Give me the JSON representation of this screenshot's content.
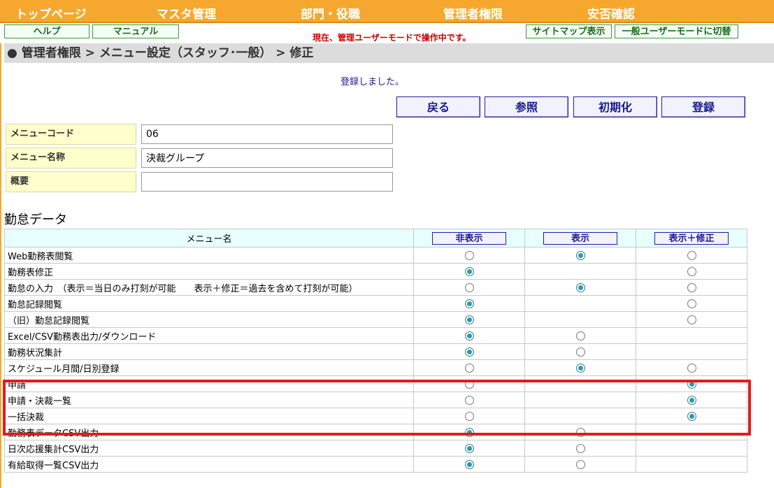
{
  "nav": [
    "トップページ",
    "マスタ管理",
    "部門・役職",
    "管理者権限",
    "安否確認"
  ],
  "subnav": {
    "help": "ヘルプ",
    "manual": "マニュアル",
    "notice": "現在、管理ユーザーモードで操作中です。",
    "sitemap": "サイトマップ表示",
    "switch": "一般ユーザーモードに切替"
  },
  "breadcrumb": "● 管理者権限 > メニュー設定（スタッフ･一般） > 修正",
  "message": "登録しました。",
  "actions": {
    "back": "戻る",
    "ref": "参照",
    "init": "初期化",
    "save": "登録"
  },
  "form": {
    "code_label": "メニューコード",
    "code_value": "06",
    "name_label": "メニュー名称",
    "name_value": "決裁グループ",
    "desc_label": "概要",
    "desc_value": ""
  },
  "section_title": "勤怠データ",
  "table": {
    "headers": {
      "menu": "メニュー名",
      "hide": "非表示",
      "show": "表示",
      "edit": "表示＋修正"
    },
    "rows": [
      {
        "name": "Web勤務表閲覧",
        "hide": "off",
        "show": "on",
        "edit": "off"
      },
      {
        "name": "勤務表修正",
        "hide": "on",
        "show": "none",
        "edit": "off"
      },
      {
        "name": "勤怠の入力　（表示＝当日のみ打刻が可能　　表示＋修正＝過去を含めて打刻が可能）",
        "hide": "off",
        "show": "on",
        "edit": "off"
      },
      {
        "name": "勤怠記録閲覧",
        "hide": "on",
        "show": "none",
        "edit": "off"
      },
      {
        "name": "（旧）勤怠記録閲覧",
        "hide": "on",
        "show": "none",
        "edit": "off"
      },
      {
        "name": "Excel/CSV勤務表出力/ダウンロード",
        "hide": "on",
        "show": "off",
        "edit": "none"
      },
      {
        "name": "勤務状況集計",
        "hide": "on",
        "show": "off",
        "edit": "none"
      },
      {
        "name": "スケジュール月間/日別登録",
        "hide": "off",
        "show": "on",
        "edit": "off"
      },
      {
        "name": "申請",
        "hide": "off",
        "show": "none",
        "edit": "on"
      },
      {
        "name": "申請・決裁一覧",
        "hide": "off",
        "show": "none",
        "edit": "on"
      },
      {
        "name": "一括決裁",
        "hide": "off",
        "show": "none",
        "edit": "on"
      },
      {
        "name": "勤務表データCSV出力",
        "hide": "on",
        "show": "off",
        "edit": "none"
      },
      {
        "name": "日次応援集計CSV出力",
        "hide": "on",
        "show": "off",
        "edit": "none"
      },
      {
        "name": "有給取得一覧CSV出力",
        "hide": "on",
        "show": "off",
        "edit": "none"
      }
    ]
  }
}
